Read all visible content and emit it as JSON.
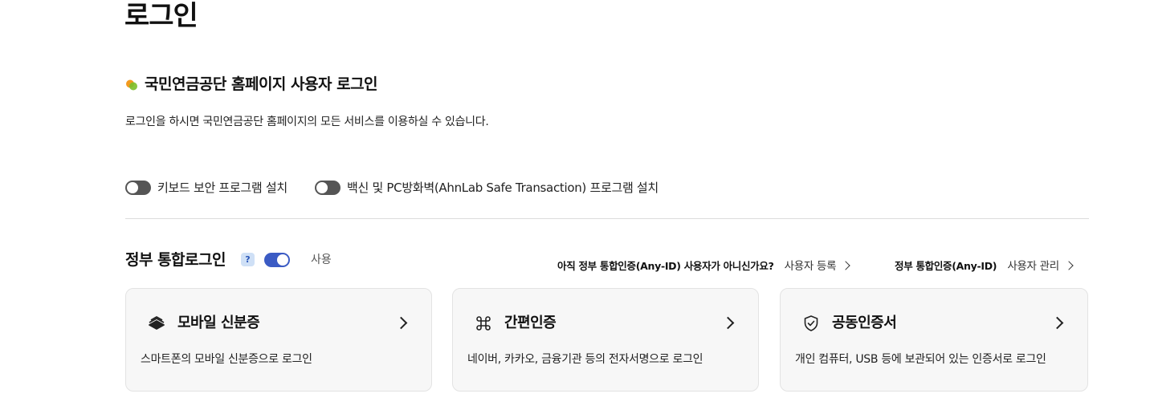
{
  "page": {
    "title": "로그인"
  },
  "section": {
    "title": "국민연금공단 홈페이지 사용자 로그인",
    "description": "로그인을 하시면 국민연금공단 홈페이지의 모든 서비스를 이용하실 수 있습니다.",
    "icon": "leaf-dot-icon",
    "colors": {
      "dot_orange": "#f39a1f",
      "dot_green": "#7bbf2a"
    }
  },
  "options": [
    {
      "label": "키보드 보안 프로그램 설치",
      "state": "off"
    },
    {
      "label": "백신 및 PC방화벽(AhnLab Safe Transaction) 프로그램 설치",
      "state": "off"
    }
  ],
  "gov_login": {
    "title": "정부 통합로그인",
    "help_icon": "?",
    "toggle_state": "on",
    "use_label": "사용",
    "register_question": "아직 정부 통합인증(Any-ID) 사용자가 아니신가요?",
    "register_link": "사용자 등록",
    "manage_prefix": "정부 통합인증(Any-ID)",
    "manage_link": "사용자 관리",
    "accent_color": "#3b5bc4"
  },
  "cards": [
    {
      "icon": "id-card-stack-icon",
      "title": "모바일 신분증",
      "description": "스마트폰의 모바일 신분증으로 로그인"
    },
    {
      "icon": "command-key-icon",
      "title": "간편인증",
      "description": "네이버, 카카오, 금융기관 등의 전자서명으로 로그인"
    },
    {
      "icon": "shield-check-icon",
      "title": "공동인증서",
      "description": "개인 컴퓨터, USB 등에 보관되어 있는 인증서로 로그인"
    }
  ]
}
